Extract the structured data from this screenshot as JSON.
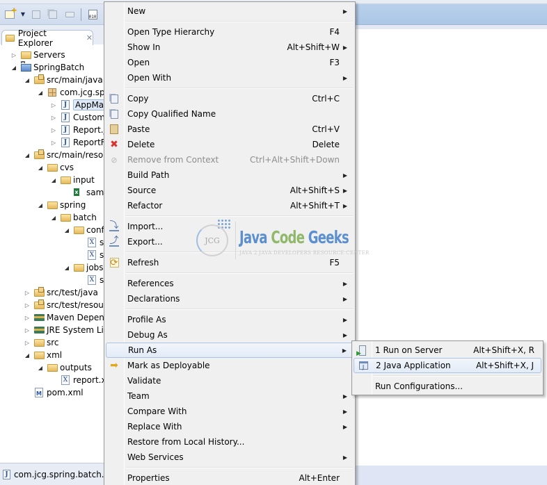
{
  "explorer": {
    "tab_label": "Project Explorer",
    "tree": [
      {
        "label": "Servers",
        "indent": 0,
        "twisty": "collapsed",
        "icon": "server-folder-icon"
      },
      {
        "label": "SpringBatch",
        "indent": 0,
        "twisty": "expanded",
        "icon": "maven-project-icon"
      },
      {
        "label": "src/main/java",
        "indent": 1,
        "twisty": "expanded",
        "icon": "source-folder-icon"
      },
      {
        "label": "com.jcg.spr",
        "indent": 2,
        "twisty": "expanded",
        "icon": "package-icon"
      },
      {
        "label": "AppMai",
        "indent": 3,
        "twisty": "collapsed",
        "icon": "java-file-icon",
        "selected": true
      },
      {
        "label": "Custom",
        "indent": 3,
        "twisty": "collapsed",
        "icon": "java-file-icon"
      },
      {
        "label": "Report.j",
        "indent": 3,
        "twisty": "collapsed",
        "icon": "java-file-icon"
      },
      {
        "label": "ReportF",
        "indent": 3,
        "twisty": "collapsed",
        "icon": "java-file-icon"
      },
      {
        "label": "src/main/resou",
        "indent": 1,
        "twisty": "expanded",
        "icon": "source-folder-icon"
      },
      {
        "label": "cvs",
        "indent": 2,
        "twisty": "expanded",
        "icon": "folder-icon"
      },
      {
        "label": "input",
        "indent": 3,
        "twisty": "expanded",
        "icon": "folder-icon"
      },
      {
        "label": "sam",
        "indent": 4,
        "twisty": "none",
        "icon": "excel-file-icon"
      },
      {
        "label": "spring",
        "indent": 2,
        "twisty": "expanded",
        "icon": "folder-icon"
      },
      {
        "label": "batch",
        "indent": 3,
        "twisty": "expanded",
        "icon": "folder-icon"
      },
      {
        "label": "conf",
        "indent": 4,
        "twisty": "expanded",
        "icon": "folder-icon"
      },
      {
        "label": "s",
        "indent": 5,
        "twisty": "none",
        "icon": "xml-file-icon"
      },
      {
        "label": "s",
        "indent": 5,
        "twisty": "none",
        "icon": "xml-file-icon"
      },
      {
        "label": "jobs",
        "indent": 4,
        "twisty": "expanded",
        "icon": "folder-icon"
      },
      {
        "label": "s",
        "indent": 5,
        "twisty": "none",
        "icon": "xml-file-icon"
      },
      {
        "label": "src/test/java",
        "indent": 1,
        "twisty": "collapsed",
        "icon": "source-folder-icon"
      },
      {
        "label": "src/test/resourc",
        "indent": 1,
        "twisty": "collapsed",
        "icon": "source-folder-icon"
      },
      {
        "label": "Maven Depend",
        "indent": 1,
        "twisty": "collapsed",
        "icon": "library-icon"
      },
      {
        "label": "JRE System Libr",
        "indent": 1,
        "twisty": "collapsed",
        "icon": "library-icon"
      },
      {
        "label": "src",
        "indent": 1,
        "twisty": "collapsed",
        "icon": "folder-icon"
      },
      {
        "label": "xml",
        "indent": 1,
        "twisty": "expanded",
        "icon": "folder-icon"
      },
      {
        "label": "outputs",
        "indent": 2,
        "twisty": "expanded",
        "icon": "folder-icon"
      },
      {
        "label": "report.x",
        "indent": 3,
        "twisty": "none",
        "icon": "xml-file-icon"
      },
      {
        "label": "pom.xml",
        "indent": 1,
        "twisty": "none",
        "icon": "maven-pom-icon"
      }
    ]
  },
  "status_bar": {
    "text": "com.jcg.spring.batch.Ap"
  },
  "context_menu": {
    "items": [
      {
        "type": "item",
        "label": "New",
        "shortcut": "",
        "submenu": true,
        "icon": ""
      },
      {
        "type": "separator"
      },
      {
        "type": "item",
        "label": "Open Type Hierarchy",
        "shortcut": "F4",
        "submenu": false,
        "icon": ""
      },
      {
        "type": "item",
        "label": "Show In",
        "shortcut": "Alt+Shift+W",
        "submenu": true,
        "icon": ""
      },
      {
        "type": "item",
        "label": "Open",
        "shortcut": "F3",
        "submenu": false,
        "icon": ""
      },
      {
        "type": "item",
        "label": "Open With",
        "shortcut": "",
        "submenu": true,
        "icon": ""
      },
      {
        "type": "separator"
      },
      {
        "type": "item",
        "label": "Copy",
        "shortcut": "Ctrl+C",
        "submenu": false,
        "icon": "copy-icon"
      },
      {
        "type": "item",
        "label": "Copy Qualified Name",
        "shortcut": "",
        "submenu": false,
        "icon": "copy-qualified-icon"
      },
      {
        "type": "item",
        "label": "Paste",
        "shortcut": "Ctrl+V",
        "submenu": false,
        "icon": "paste-icon"
      },
      {
        "type": "item",
        "label": "Delete",
        "shortcut": "Delete",
        "submenu": false,
        "icon": "delete-icon"
      },
      {
        "type": "item",
        "label": "Remove from Context",
        "shortcut": "Ctrl+Alt+Shift+Down",
        "submenu": false,
        "icon": "remove-context-icon",
        "disabled": true
      },
      {
        "type": "item",
        "label": "Build Path",
        "shortcut": "",
        "submenu": true,
        "icon": ""
      },
      {
        "type": "item",
        "label": "Source",
        "shortcut": "Alt+Shift+S",
        "submenu": true,
        "icon": ""
      },
      {
        "type": "item",
        "label": "Refactor",
        "shortcut": "Alt+Shift+T",
        "submenu": true,
        "icon": ""
      },
      {
        "type": "separator"
      },
      {
        "type": "item",
        "label": "Import...",
        "shortcut": "",
        "submenu": false,
        "icon": "import-icon"
      },
      {
        "type": "item",
        "label": "Export...",
        "shortcut": "",
        "submenu": false,
        "icon": "export-icon"
      },
      {
        "type": "separator"
      },
      {
        "type": "item",
        "label": "Refresh",
        "shortcut": "F5",
        "submenu": false,
        "icon": "refresh-icon"
      },
      {
        "type": "separator"
      },
      {
        "type": "item",
        "label": "References",
        "shortcut": "",
        "submenu": true,
        "icon": ""
      },
      {
        "type": "item",
        "label": "Declarations",
        "shortcut": "",
        "submenu": true,
        "icon": ""
      },
      {
        "type": "separator"
      },
      {
        "type": "item",
        "label": "Profile As",
        "shortcut": "",
        "submenu": true,
        "icon": ""
      },
      {
        "type": "item",
        "label": "Debug As",
        "shortcut": "",
        "submenu": true,
        "icon": ""
      },
      {
        "type": "item",
        "label": "Run As",
        "shortcut": "",
        "submenu": true,
        "icon": "",
        "highlighted": true
      },
      {
        "type": "item",
        "label": "Mark as Deployable",
        "shortcut": "",
        "submenu": false,
        "icon": "deployable-icon"
      },
      {
        "type": "item",
        "label": "Validate",
        "shortcut": "",
        "submenu": false,
        "icon": ""
      },
      {
        "type": "item",
        "label": "Team",
        "shortcut": "",
        "submenu": true,
        "icon": ""
      },
      {
        "type": "item",
        "label": "Compare With",
        "shortcut": "",
        "submenu": true,
        "icon": ""
      },
      {
        "type": "item",
        "label": "Replace With",
        "shortcut": "",
        "submenu": true,
        "icon": ""
      },
      {
        "type": "item",
        "label": "Restore from Local History...",
        "shortcut": "",
        "submenu": false,
        "icon": ""
      },
      {
        "type": "item",
        "label": "Web Services",
        "shortcut": "",
        "submenu": true,
        "icon": ""
      },
      {
        "type": "separator"
      },
      {
        "type": "item",
        "label": "Properties",
        "shortcut": "Alt+Enter",
        "submenu": false,
        "icon": ""
      }
    ]
  },
  "run_as_submenu": {
    "items": [
      {
        "type": "item",
        "label": "1 Run on Server",
        "shortcut": "Alt+Shift+X, R",
        "icon": "run-on-server-icon"
      },
      {
        "type": "item",
        "label": "2 Java Application",
        "shortcut": "Alt+Shift+X, J",
        "icon": "java-application-icon",
        "highlighted": true
      },
      {
        "type": "separator"
      },
      {
        "type": "item",
        "label": "Run Configurations...",
        "shortcut": "",
        "icon": ""
      }
    ]
  },
  "watermark": {
    "logo_text": "JCG",
    "title_parts": [
      "Java",
      "Code",
      "Geeks"
    ],
    "subtitle": "JAVA 2 JAVA DEVELOPERS RESOURCE CENTER"
  },
  "colors": {
    "menu_background": "#f0f0f0",
    "highlight_border": "#a8c3e3",
    "editor_header": "#b0cbe8",
    "watermark_blue": "#5b8fcf",
    "watermark_green": "#8fb86a"
  }
}
